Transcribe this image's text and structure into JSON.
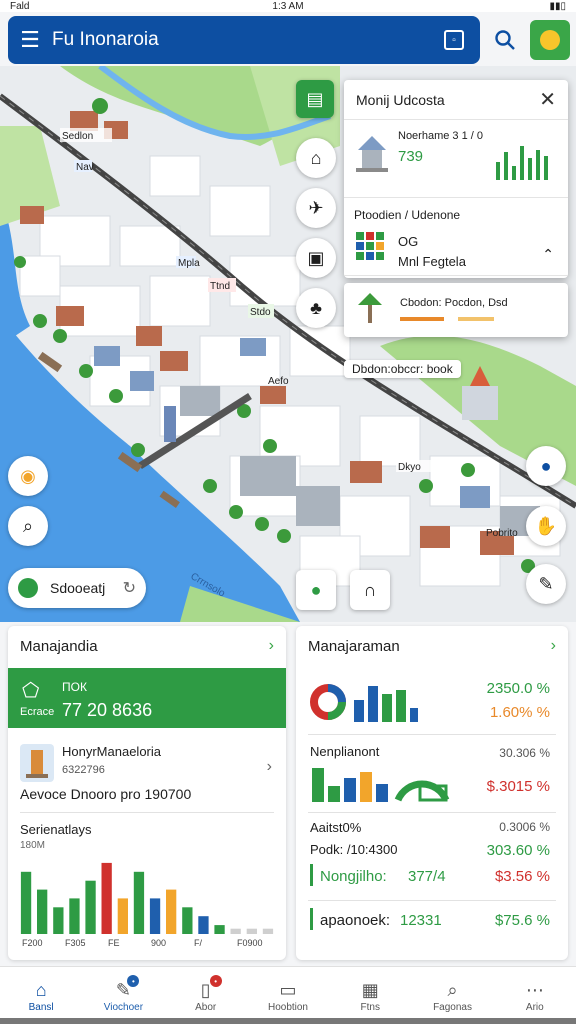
{
  "status": {
    "left": "Fald",
    "time": "1:3 AM"
  },
  "appbar": {
    "title": "Fu Inonaroia",
    "menu_icon": "menu-icon",
    "action_icon": "square-icon"
  },
  "map": {
    "labels": [
      "Sedlon",
      "Nav",
      "Mpla",
      "Ttnd",
      "Stdo",
      "Aefo",
      "Dkyo",
      "Pobrito",
      "Crrnsolo"
    ],
    "chip_text": "Dbdon:obccr: book"
  },
  "popup": {
    "title": "Monij Udcosta",
    "sec1_title": "Noerhame 3 1 / 0",
    "sec1_value": "739",
    "sec2_title": "Ptoodien / Udenone",
    "sec2_code": "OG",
    "sec2_name": "Mnl Fegtela",
    "sec3_title": "Cbodon: Pocdon, Dsd"
  },
  "schedule": {
    "label": "Sdooeatj",
    "icon": "refresh-icon"
  },
  "left_card": {
    "title": "Manajandia",
    "band_label": "ПОК",
    "band_sub": "Ecrace",
    "band_value": "77 20 8636",
    "item_title": "HonyrManaeloria",
    "item_sub": "6322796",
    "item_line": "Aevoce Dnooro pro 190700",
    "chart_title": "Serienatlays",
    "chart_sub": "180M"
  },
  "right_card": {
    "title": "Manajaraman",
    "pct1": "2350.0 %",
    "pct2": "1.60%  %",
    "row2_title": "Nenplianont",
    "row2_value": "30.306 %",
    "row2_pct": "$.3015 %",
    "row3_title": "Aaitst0%",
    "row3_value": "0.3006 %",
    "row3_label": "Podk: /10:4300",
    "row3_pct": "303.60 %",
    "row4_label": "Nongjilho:",
    "row4_num": "377/4",
    "row4_pct": "$3.56 %",
    "row5_label": "apaonoek:",
    "row5_num": "12331",
    "row5_pct": "$75.6 %"
  },
  "chart_data": {
    "type": "bar",
    "categories": [
      "F200",
      "F305",
      "FE",
      "900",
      "F/"
    ],
    "series": [
      {
        "name": "",
        "values": [
          7,
          5,
          3,
          4,
          6,
          8,
          4,
          7,
          4,
          5,
          3,
          2,
          1,
          0.6,
          0.6,
          0.6
        ]
      }
    ],
    "colors": [
      "#2e9b44",
      "#2e9b44",
      "#2e9b44",
      "#2e9b44",
      "#2e9b44",
      "#d0312d",
      "#f2a52b",
      "#2e9b44",
      "#1f5fad",
      "#f2a52b",
      "#2e9b44",
      "#1f5fad",
      "#2e9b44",
      "#cfcfcf",
      "#cfcfcf",
      "#cfcfcf"
    ],
    "extra_tick": "F0900",
    "ylim": [
      0,
      9
    ]
  },
  "nav": {
    "items": [
      {
        "label": "Bansl",
        "icon": "home-icon"
      },
      {
        "label": "Viochoer",
        "icon": "edit-icon"
      },
      {
        "label": "Abor",
        "icon": "doc-icon"
      },
      {
        "label": "Hoobtion",
        "icon": "camera-icon"
      },
      {
        "label": "Ftns",
        "icon": "calendar-icon"
      },
      {
        "label": "Fagonas",
        "icon": "search-icon"
      },
      {
        "label": "Ario",
        "icon": "more-icon"
      }
    ]
  },
  "colors": {
    "primary": "#0d4fa2",
    "accent": "#2e9b44",
    "water": "#4c9be6"
  }
}
